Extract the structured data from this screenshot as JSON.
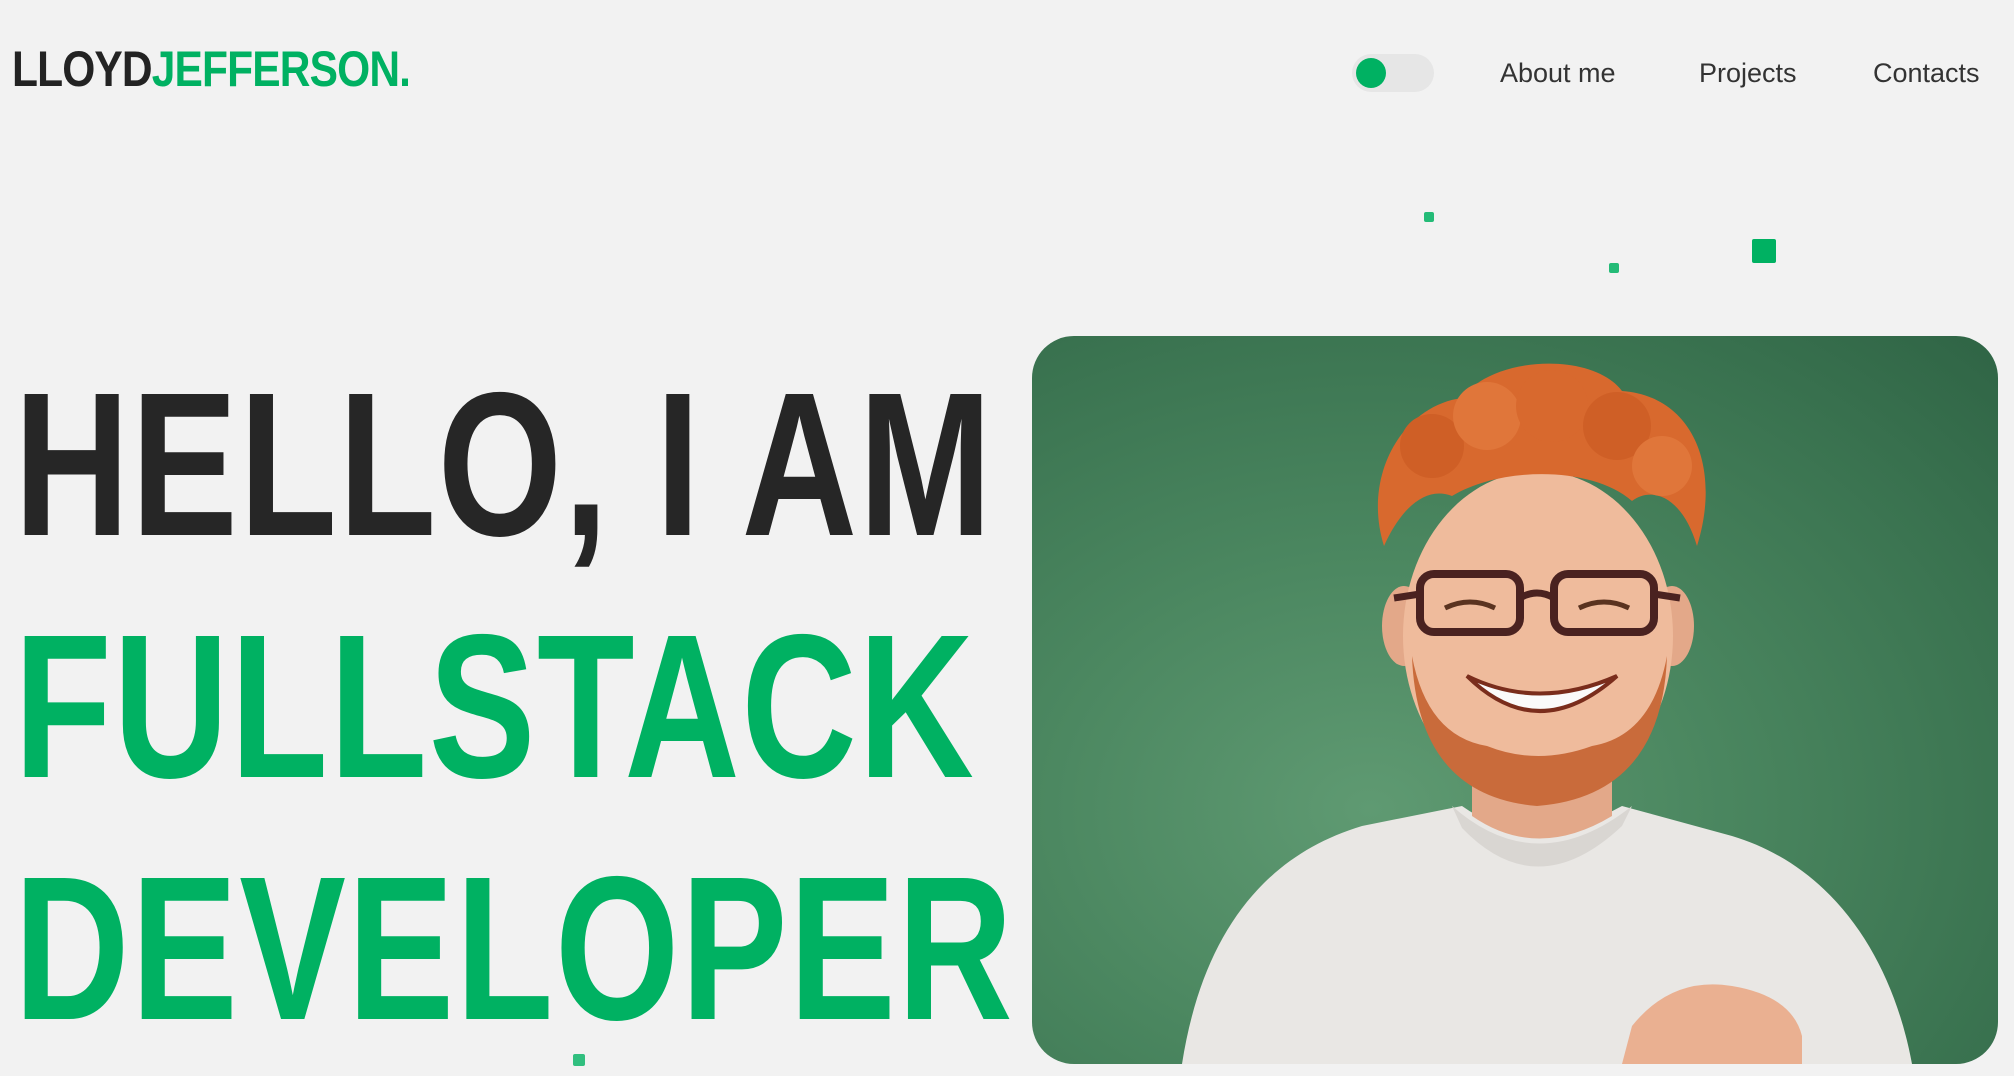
{
  "header": {
    "logo_first": "LLOYD",
    "logo_last": "JEFFERSON.",
    "theme_toggle": {
      "state": "on"
    },
    "nav": {
      "about": "About me",
      "projects": "Projects",
      "contacts": "Contacts"
    }
  },
  "hero": {
    "line1": "HELLO, I AM",
    "line2": "FULLSTACK",
    "line3": "DEVELOPER"
  },
  "photo": {
    "subject": "smiling red-haired man with glasses in white t-shirt on green background"
  },
  "colors": {
    "accent": "#00b162",
    "text_dark": "#262626",
    "background": "#f2f2f2",
    "photo_bg": "#3f7a52"
  }
}
